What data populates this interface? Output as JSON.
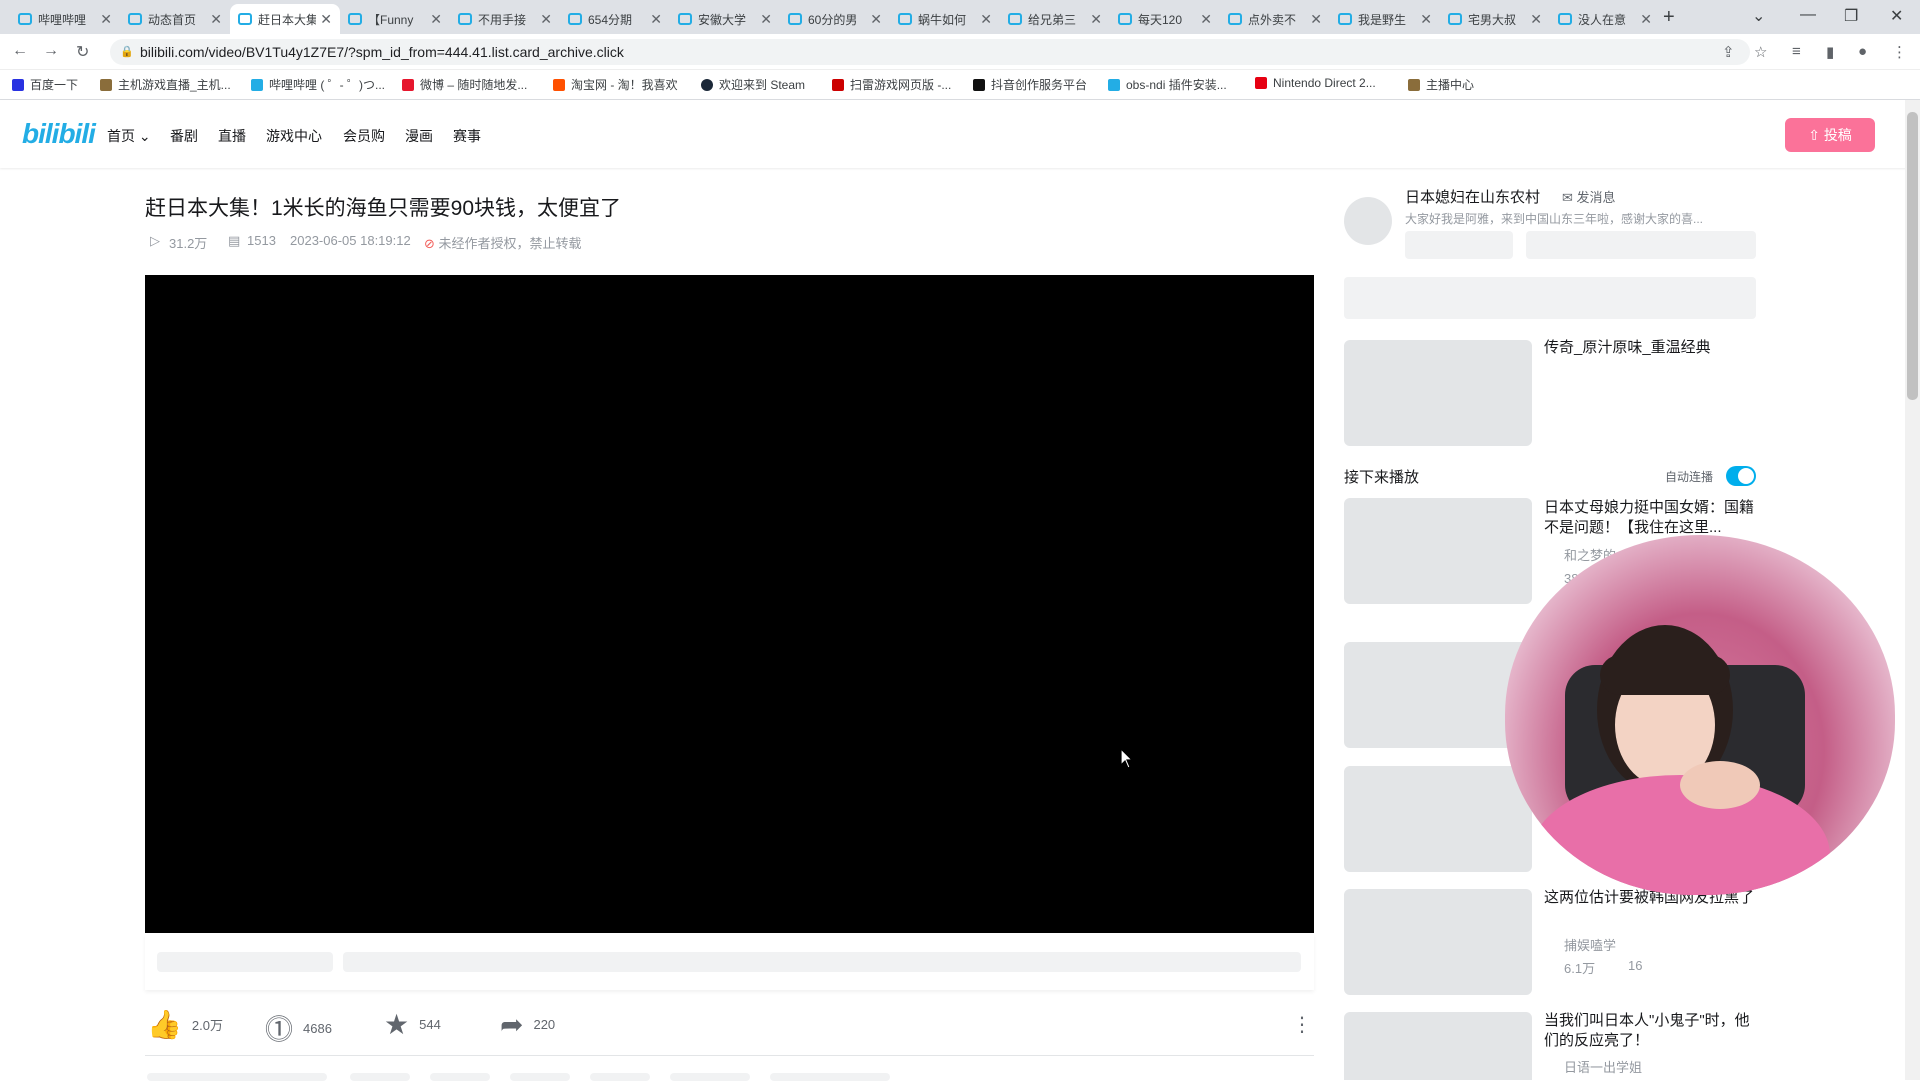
{
  "browser": {
    "tabs": [
      {
        "label": "哔哩哔哩"
      },
      {
        "label": "动态首页"
      },
      {
        "label": "赶日本大集"
      },
      {
        "label": "【Funny"
      },
      {
        "label": "不用手接"
      },
      {
        "label": "654分期"
      },
      {
        "label": "安徽大学"
      },
      {
        "label": "60分的男"
      },
      {
        "label": "蜗牛如何"
      },
      {
        "label": "给兄弟三"
      },
      {
        "label": "每天120"
      },
      {
        "label": "点外卖不"
      },
      {
        "label": "我是野生"
      },
      {
        "label": "宅男大叔"
      },
      {
        "label": "没人在意"
      }
    ],
    "url": "bilibili.com/video/BV1Tu4y1Z7E7/?spm_id_from=444.41.list.card_archive.click",
    "bookmarks": [
      {
        "label": "百度一下",
        "color": "#2932e1"
      },
      {
        "label": "主机游戏直播_主机...",
        "color": "#8a6d3b"
      },
      {
        "label": "哔哩哔哩 ( ゜- ゜)つ...",
        "color": "#23ade5"
      },
      {
        "label": "微博 – 随时随地发...",
        "color": "#e6162d"
      },
      {
        "label": "淘宝网 - 淘！我喜欢",
        "color": "#ff5000"
      },
      {
        "label": "欢迎来到 Steam",
        "color": "#1b2838"
      },
      {
        "label": "扫雷游戏网页版 -...",
        "color": "#c00"
      },
      {
        "label": "抖音创作服务平台",
        "color": "#111"
      },
      {
        "label": "obs-ndi 插件安装...",
        "color": "#23ade5"
      },
      {
        "label": "Nintendo Direct 2...",
        "color": "#e60012"
      },
      {
        "label": "主播中心",
        "color": "#8a6d3b"
      }
    ]
  },
  "site": {
    "logo": "bilibili",
    "nav": [
      "首页",
      "番剧",
      "直播",
      "游戏中心",
      "会员购",
      "漫画",
      "赛事"
    ],
    "upload_label": "投稿"
  },
  "video": {
    "title": "赶日本大集！1米长的海鱼只需要90块钱，太便宜了",
    "views": "31.2万",
    "danmaku": "1513",
    "date": "2023-06-05 18:19:12",
    "copyright": "未经作者授权，禁止转载",
    "likes": "2.0万",
    "coins": "4686",
    "favorites": "544",
    "shares": "220"
  },
  "uploader": {
    "name": "日本媳妇在山东农村",
    "message_label": "发消息",
    "desc": "大家好我是阿雅，来到中国山东三年啦，感谢大家的喜..."
  },
  "sidebar": {
    "ad_title": "传奇_原汁原味_重温经典",
    "next_label": "接下来播放",
    "autoplay_label": "自动连播",
    "autoplay_on": true,
    "cards": [
      {
        "title": "日本丈母娘力挺中国女婿：国籍不是问题！【我住在这里...",
        "author": "和之梦的",
        "views": "38.9万",
        "comments": ""
      },
      {
        "title": "这两位估计要被韩国网友拉黑了",
        "author": "捕娱嗑学",
        "views": "6.1万",
        "comments": "16"
      },
      {
        "title": "当我们叫日本人\"小鬼子\"时，他们的反应亮了！",
        "author": "日语一出学姐",
        "views": "",
        "comments": ""
      }
    ]
  },
  "colors": {
    "brand": "#23ade5",
    "upload": "#fb7299",
    "toggle": "#00aeec"
  }
}
